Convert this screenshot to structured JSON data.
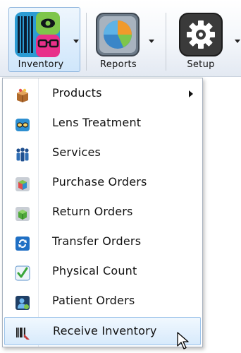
{
  "toolbar": {
    "buttons": [
      {
        "label": "Inventory",
        "icon": "inventory-barcode-glasses-icon"
      },
      {
        "label": "Reports",
        "icon": "pie-chart-icon"
      },
      {
        "label": "Setup",
        "icon": "gear-icon"
      }
    ]
  },
  "menu": {
    "items": [
      {
        "label": "Products",
        "icon": "products-box-icon",
        "has_submenu": true
      },
      {
        "label": "Lens Treatment",
        "icon": "lens-treatment-icon"
      },
      {
        "label": "Services",
        "icon": "services-people-icon"
      },
      {
        "label": "Purchase Orders",
        "icon": "purchase-orders-icon"
      },
      {
        "label": "Return Orders",
        "icon": "return-orders-icon"
      },
      {
        "label": "Transfer Orders",
        "icon": "transfer-orders-icon"
      },
      {
        "label": "Physical Count",
        "icon": "physical-count-check-icon"
      },
      {
        "label": "Patient Orders",
        "icon": "patient-orders-icon"
      },
      {
        "label": "Receive Inventory",
        "icon": "receive-inventory-barcode-icon",
        "highlighted": true
      }
    ]
  },
  "colors": {
    "menu_highlight": "#d7eafc",
    "active_button_border": "#8fb5dd"
  }
}
